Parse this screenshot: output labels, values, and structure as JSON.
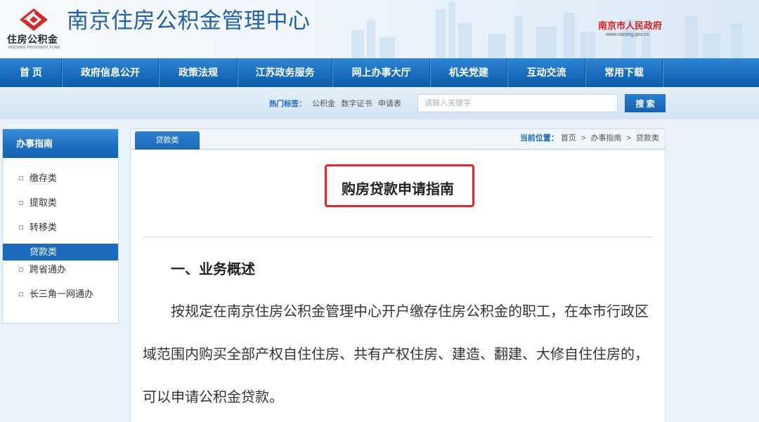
{
  "header": {
    "logo_text": "住房公积金",
    "logo_subtext": "HOUSING PROVIDENT FUND",
    "site_title": "南京住房公积金管理中心",
    "gov_name": "南京市人民政府",
    "gov_url": "www.nanjing.gov.cn"
  },
  "nav": {
    "items": [
      "首 页",
      "政府信息公开",
      "政策法规",
      "江苏政务服务",
      "网上办事大厅",
      "机关党建",
      "互动交流",
      "常用下载"
    ]
  },
  "search": {
    "hot_label": "热门标签：",
    "hot_tags": [
      "公积金",
      "数字证书",
      "申请表"
    ],
    "placeholder": "请输入关键字",
    "button_label": "搜 索"
  },
  "sidebar": {
    "title": "办事指南",
    "items": [
      {
        "label": "缴存类",
        "active": false
      },
      {
        "label": "提取类",
        "active": false
      },
      {
        "label": "转移类",
        "active": false
      },
      {
        "label": "贷款类",
        "active": true
      },
      {
        "label": "跨省通办",
        "active": false
      },
      {
        "label": "长三角一网通办",
        "active": false
      }
    ]
  },
  "content": {
    "tab_label": "贷款类",
    "breadcrumb_label": "当前位置：",
    "breadcrumb": [
      "首页",
      "办事指南",
      "贷款类"
    ],
    "breadcrumb_separator": ">",
    "article_title": "购房贷款申请指南",
    "section_heading": "一、业务概述",
    "paragraph_lines": [
      "按规定在南京住房公积金管理中心开户缴存住房公积金的职工，在本市行政区",
      "域范围内购买全部产权自住住房、共有产权住房、建造、翻建、大修自住住房的，",
      "可以申请公积金贷款。"
    ]
  },
  "icons": {
    "logo": "provident-fund-logo-icon",
    "bullet": "square-bullet-icon"
  },
  "colors": {
    "brand_blue": "#1b69bc",
    "title_blue": "#1f60ae",
    "gov_red": "#d71f1f",
    "highlight_red": "#e3282d",
    "page_bg": "#eaf2fa"
  }
}
